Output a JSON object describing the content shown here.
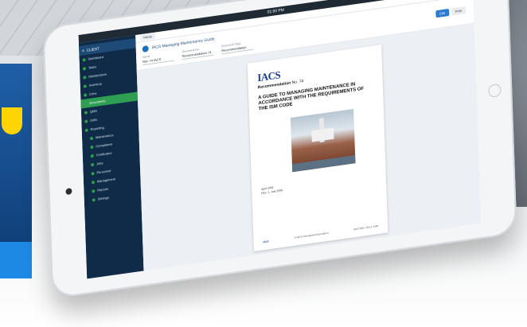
{
  "status_bar": {
    "time": "01:00 PM",
    "right": ""
  },
  "app": {
    "account": "CLIENT",
    "nav": [
      {
        "label": "Dashboard",
        "active": false
      },
      {
        "label": "Tasks",
        "active": false
      },
      {
        "label": "Maintenance",
        "active": false
      },
      {
        "label": "Inventory",
        "active": false
      },
      {
        "label": "Crew",
        "active": false
      },
      {
        "label": "Documents",
        "active": true
      },
      {
        "label": "QMS",
        "active": false
      },
      {
        "label": "Drills",
        "active": false
      },
      {
        "label": "Reporting",
        "active": false
      },
      {
        "label": "Maintenance",
        "active": false
      },
      {
        "label": "Compliance",
        "active": false
      },
      {
        "label": "Certificates",
        "active": false
      },
      {
        "label": "Jobs",
        "active": false
      },
      {
        "label": "Personnel",
        "active": false
      },
      {
        "label": "Management",
        "active": false
      },
      {
        "label": "Reports",
        "active": false
      },
      {
        "label": "Settings",
        "active": false
      }
    ]
  },
  "topbar": {
    "tab": "Home"
  },
  "document": {
    "title": "IACS Managing Maintenance Guide",
    "fields": [
      {
        "label": "Name",
        "value": "Rec 74 IACS"
      },
      {
        "label": "Document No.",
        "value": "Recommendation 74"
      },
      {
        "label": "Document Type",
        "value": "Recommendation"
      }
    ],
    "actions": {
      "primary": "Edit",
      "secondary": "Print"
    }
  },
  "page": {
    "logo": "IACS",
    "rec_label": "Recommendation",
    "rec_no": "No. 74",
    "heading": "A GUIDE TO MANAGING MAINTENANCE IN ACCORDANCE WITH THE REQUIREMENTS OF THE ISM CODE",
    "small_lines": [
      "April 2001",
      "Rev. 1, July 2008"
    ],
    "footer_left": "IACS",
    "footer_mid": "© IACS International Association",
    "footer_right": "April 2001 / Rev.1 2008"
  }
}
